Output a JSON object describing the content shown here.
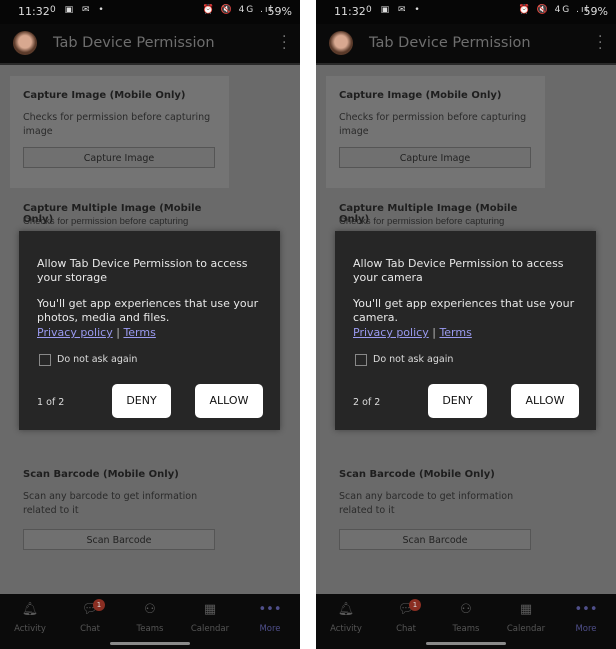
{
  "status_bar": {
    "time": "11:32",
    "left_icons": "0 ▣ ✉ •",
    "right_icons": "⏰ 🔇 4G .ıl",
    "battery": "59%"
  },
  "app": {
    "title": "Tab Device Permission"
  },
  "cards": [
    {
      "title": "Capture Image (Mobile Only)",
      "description": "Checks for permission before capturing image",
      "button": "Capture Image"
    },
    {
      "title": "Capture Multiple Image (Mobile Only)",
      "description": "Checks for permission before capturing"
    },
    {
      "title": "Scan Barcode (Mobile Only)",
      "description": "Scan any barcode to get information related to it",
      "button": "Scan Barcode"
    }
  ],
  "tabs": [
    {
      "label": "Activity",
      "icon": "bell-icon"
    },
    {
      "label": "Chat",
      "icon": "chat-icon",
      "badge": "1"
    },
    {
      "label": "Teams",
      "icon": "teams-icon"
    },
    {
      "label": "Calendar",
      "icon": "calendar-icon"
    },
    {
      "label": "More",
      "icon": "more-icon",
      "active": true
    }
  ],
  "colors": {
    "accent": "#4f4f8a",
    "link": "#9a9af0",
    "badge": "#8a2e22"
  },
  "phones": [
    {
      "dialog": {
        "title": "Allow Tab Device Permission to access your storage",
        "body": "You'll get app experiences that use your photos, media and files.",
        "privacy": "Privacy policy",
        "separator": "|",
        "terms": "Terms",
        "checkbox_label": "Do not ask again",
        "checked": false,
        "counter": "1 of 2",
        "deny": "DENY",
        "allow": "ALLOW"
      }
    },
    {
      "dialog": {
        "title": "Allow Tab Device Permission to access your camera",
        "body": "You'll get app experiences that use your camera.",
        "privacy": "Privacy policy",
        "separator": "|",
        "terms": "Terms",
        "checkbox_label": "Do not ask again",
        "checked": false,
        "counter": "2 of 2",
        "deny": "DENY",
        "allow": "ALLOW"
      }
    }
  ]
}
